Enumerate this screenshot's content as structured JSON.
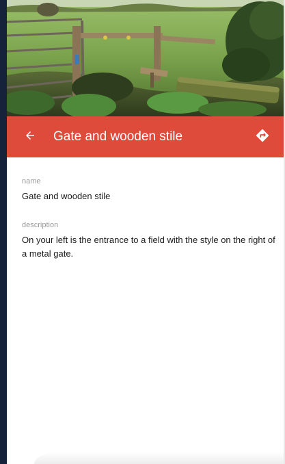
{
  "header": {
    "title": "Gate and wooden stile",
    "back_icon": "arrow-back-icon",
    "directions_icon": "directions-icon"
  },
  "hero_image": {
    "subject": "photo-gate-and-wooden-stile"
  },
  "fields": {
    "name_label": "name",
    "name_value": "Gate and wooden stile",
    "description_label": "description",
    "description_value": "On your left is the entrance to a field with the style on the right of a metal gate."
  },
  "colors": {
    "appbar": "#df4b3a",
    "appbar_text": "#ffffff",
    "label_text": "#9a9a9a",
    "body_text": "#1a1a1a",
    "left_edge": "#16213a"
  }
}
